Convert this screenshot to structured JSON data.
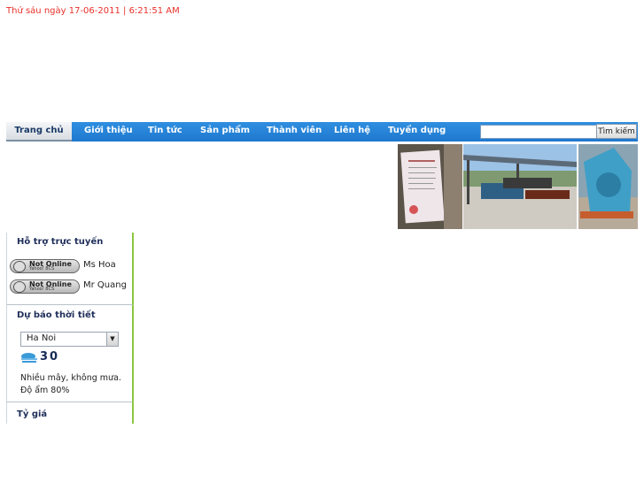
{
  "header": {
    "datetime": "Thứ sáu ngày 17-06-2011 | 6:21:51 AM"
  },
  "nav": {
    "items": [
      {
        "label": "Trang chủ",
        "active": true
      },
      {
        "label": "Giới thiệu"
      },
      {
        "label": "Tin tức"
      },
      {
        "label": "Sản phẩm"
      },
      {
        "label": "Thành viên"
      },
      {
        "label": "Liên hệ"
      },
      {
        "label": "Tuyển dụng"
      }
    ],
    "search": {
      "value": "",
      "placeholder": "",
      "button_label": "Tìm kiếm"
    }
  },
  "colors": {
    "nav_bg": "#1f78cf",
    "datetime": "#e8302a",
    "sidebar_accent": "#8cc63f"
  },
  "sidebar": {
    "support": {
      "title": "Hỗ trợ trực tuyến",
      "contacts": [
        {
          "status": "Not Online",
          "status_sub": "Yahoo! 8CS",
          "name": "Ms Hoa"
        },
        {
          "status": "Not Online",
          "status_sub": "Yahoo! 8CS",
          "name": "Mr Quang"
        }
      ]
    },
    "weather": {
      "title": "Dự báo thời tiết",
      "city": "Ha Noi",
      "temperature": "30",
      "description": "Nhiều mây, không mưa. Độ ẩm 80%"
    },
    "exchange": {
      "title": "Tỷ giá"
    }
  }
}
